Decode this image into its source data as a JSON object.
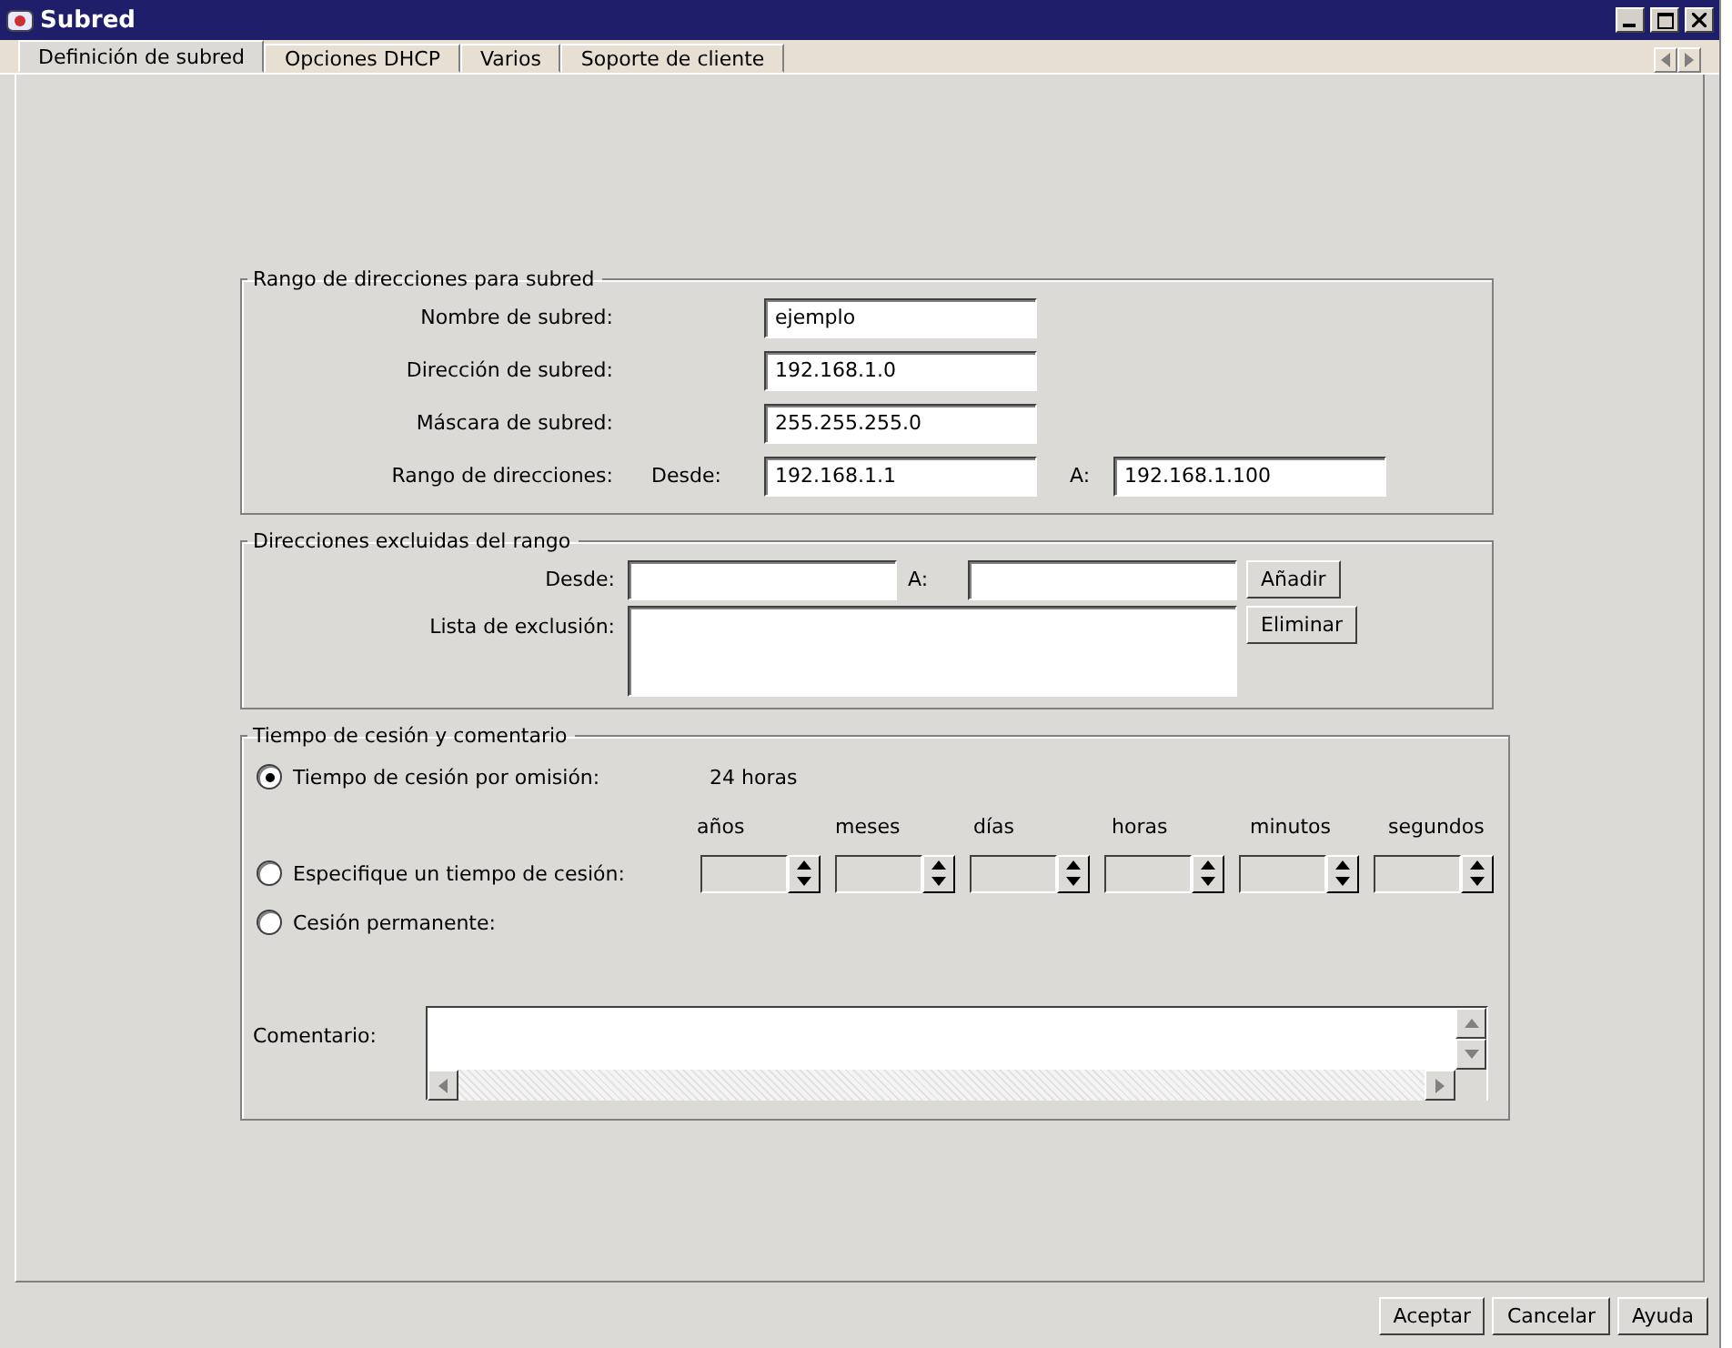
{
  "window": {
    "title": "Subred"
  },
  "tabs": [
    {
      "label": "Definición de subred",
      "selected": true
    },
    {
      "label": "Opciones DHCP",
      "selected": false
    },
    {
      "label": "Varios",
      "selected": false
    },
    {
      "label": "Soporte de cliente",
      "selected": false
    }
  ],
  "subnet_range": {
    "title": "Rango de direcciones para subred",
    "name": {
      "label": "Nombre de subred:",
      "value": "ejemplo"
    },
    "address": {
      "label": "Dirección de subred:",
      "value": "192.168.1.0"
    },
    "mask": {
      "label": "Máscara de subred:",
      "value": "255.255.255.0"
    },
    "range": {
      "label": "Rango de direcciones:",
      "from_label": "Desde:",
      "from": "192.168.1.1",
      "to_label": "A:",
      "to": "192.168.1.100"
    }
  },
  "excluded": {
    "title": "Direcciones excluidas del rango",
    "from_label": "Desde:",
    "to_label": "A:",
    "add_button": "Añadir",
    "list_label": "Lista de exclusión:",
    "remove_button": "Eliminar"
  },
  "lease": {
    "title": "Tiempo de cesión y comentario",
    "default": {
      "label": "Tiempo de cesión por omisión:",
      "value": "24 horas",
      "selected": true
    },
    "specify": {
      "label": "Especifique un tiempo de cesión:",
      "selected": false
    },
    "permanent": {
      "label": "Cesión permanente:",
      "selected": false
    },
    "units": [
      "años",
      "meses",
      "días",
      "horas",
      "minutos",
      "segundos"
    ],
    "comment_label": "Comentario:"
  },
  "buttons": [
    "Aceptar",
    "Cancelar",
    "Ayuda"
  ]
}
